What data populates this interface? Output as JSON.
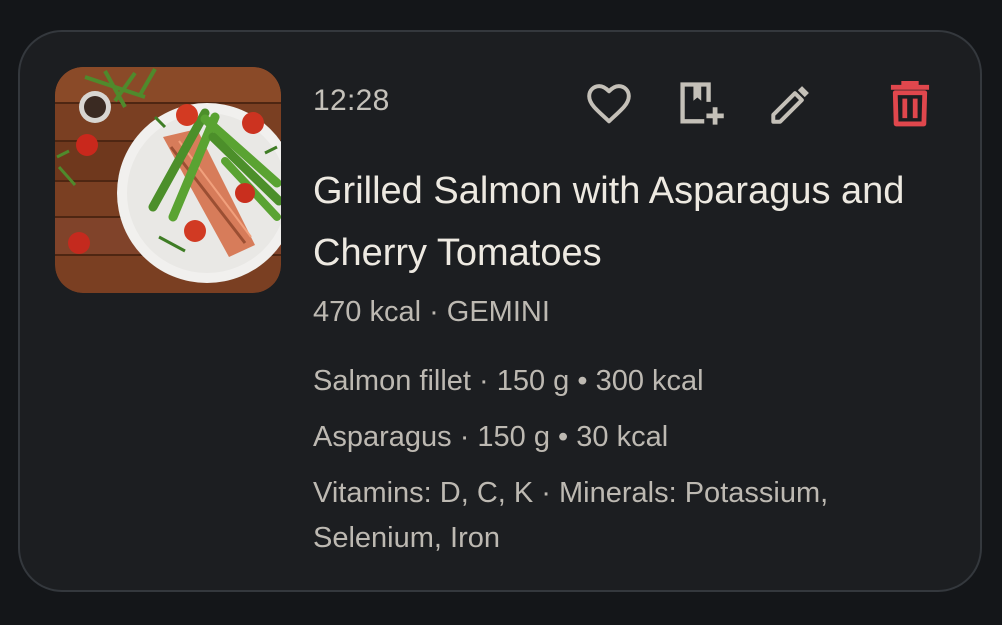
{
  "card": {
    "time": "12:28",
    "title": "Grilled Salmon with Asparagus and Cherry Tomatoes",
    "summary": "470 kcal · GEMINI",
    "ingredients": [
      "Salmon fillet · 150 g • 300 kcal",
      "Asparagus · 150 g • 30 kcal"
    ],
    "nutrients": "Vitamins: D, C, K · Minerals: Potassium, Selenium, Iron",
    "actions": {
      "favorite_icon": "heart-outline-icon",
      "save_icon": "bookmark-add-icon",
      "edit_icon": "pencil-icon",
      "delete_icon": "trash-icon"
    },
    "colors": {
      "icon": "#c4c0b8",
      "delete": "#e0474d",
      "card_background": "#1c1e21",
      "page_background": "#141619"
    }
  }
}
